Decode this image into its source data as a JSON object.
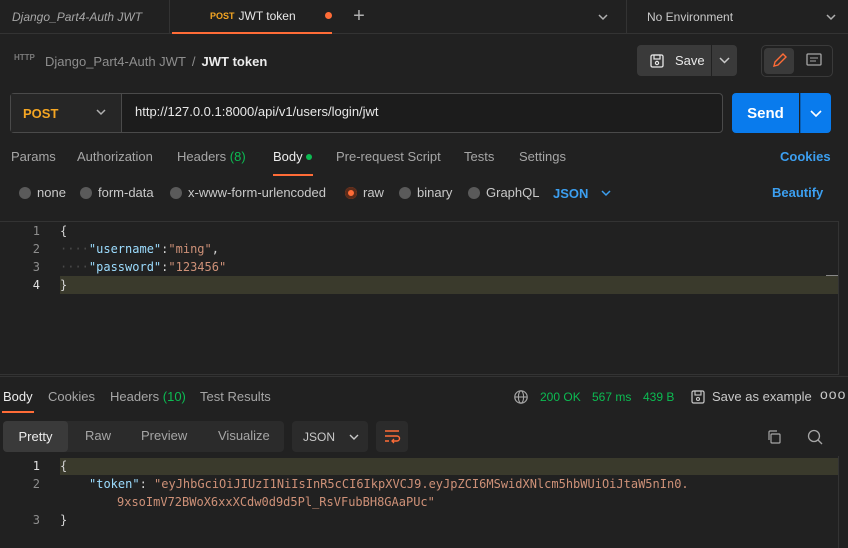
{
  "tabs": {
    "tab1": {
      "label": "Django_Part4-Auth JWT"
    },
    "tab2": {
      "method": "POST",
      "label": "JWT token"
    },
    "plus": "+",
    "environment": "No Environment"
  },
  "header": {
    "icon_text": "HTTP",
    "collection": "Django_Part4-Auth JWT",
    "separator": "/",
    "request_name": "JWT token",
    "save_label": "Save"
  },
  "request": {
    "method": "POST",
    "url": "http://127.0.0.1:8000/api/v1/users/login/jwt",
    "send_label": "Send"
  },
  "request_tabs": {
    "params": "Params",
    "authorization": "Authorization",
    "headers": "Headers",
    "headers_count": "(8)",
    "body": "Body",
    "pre_request": "Pre-request Script",
    "tests": "Tests",
    "settings": "Settings",
    "cookies": "Cookies"
  },
  "body_types": {
    "none": "none",
    "form_data": "form-data",
    "urlencoded": "x-www-form-urlencoded",
    "raw": "raw",
    "binary": "binary",
    "graphql": "GraphQL",
    "json": "JSON",
    "beautify": "Beautify"
  },
  "editor": {
    "lines": [
      {
        "num": "1",
        "text": "{"
      },
      {
        "num": "2",
        "key": "\"username\"",
        "sep": ":",
        "value": "\"ming\"",
        "trail": ","
      },
      {
        "num": "3",
        "key": "\"password\"",
        "sep": ":",
        "value": "\"123456\"",
        "trail": ""
      },
      {
        "num": "4",
        "text": "}"
      }
    ]
  },
  "response_tabs": {
    "body": "Body",
    "cookies": "Cookies",
    "headers": "Headers",
    "headers_count": "(10)",
    "test_results": "Test Results",
    "status": "200 OK",
    "time": "567 ms",
    "size": "439 B",
    "save_example": "Save as example",
    "more": "ooo"
  },
  "response_format": {
    "pretty": "Pretty",
    "raw": "Raw",
    "preview": "Preview",
    "visualize": "Visualize",
    "json": "JSON"
  },
  "response_body": {
    "lines": [
      {
        "num": "1",
        "text": "{"
      },
      {
        "num": "2",
        "key": "\"token\"",
        "sep": ": ",
        "value1": "\"eyJhbGciOiJIUzI1NiIsInR5cCI6IkpXVCJ9.eyJpZCI6MSwidXNlcm5hbWUiOiJtaW5nIn0.",
        "value2": "9xsoImV72BWoX6xxXCdw0d9d5Pl_RsVFubBH8GAaPUc\""
      },
      {
        "num": "3",
        "text": "}"
      }
    ]
  },
  "colors": {
    "accent": "#ff6c37",
    "send": "#097bed",
    "success": "#0cbb52",
    "link": "#3c9ff0",
    "method": "#f5a623"
  }
}
